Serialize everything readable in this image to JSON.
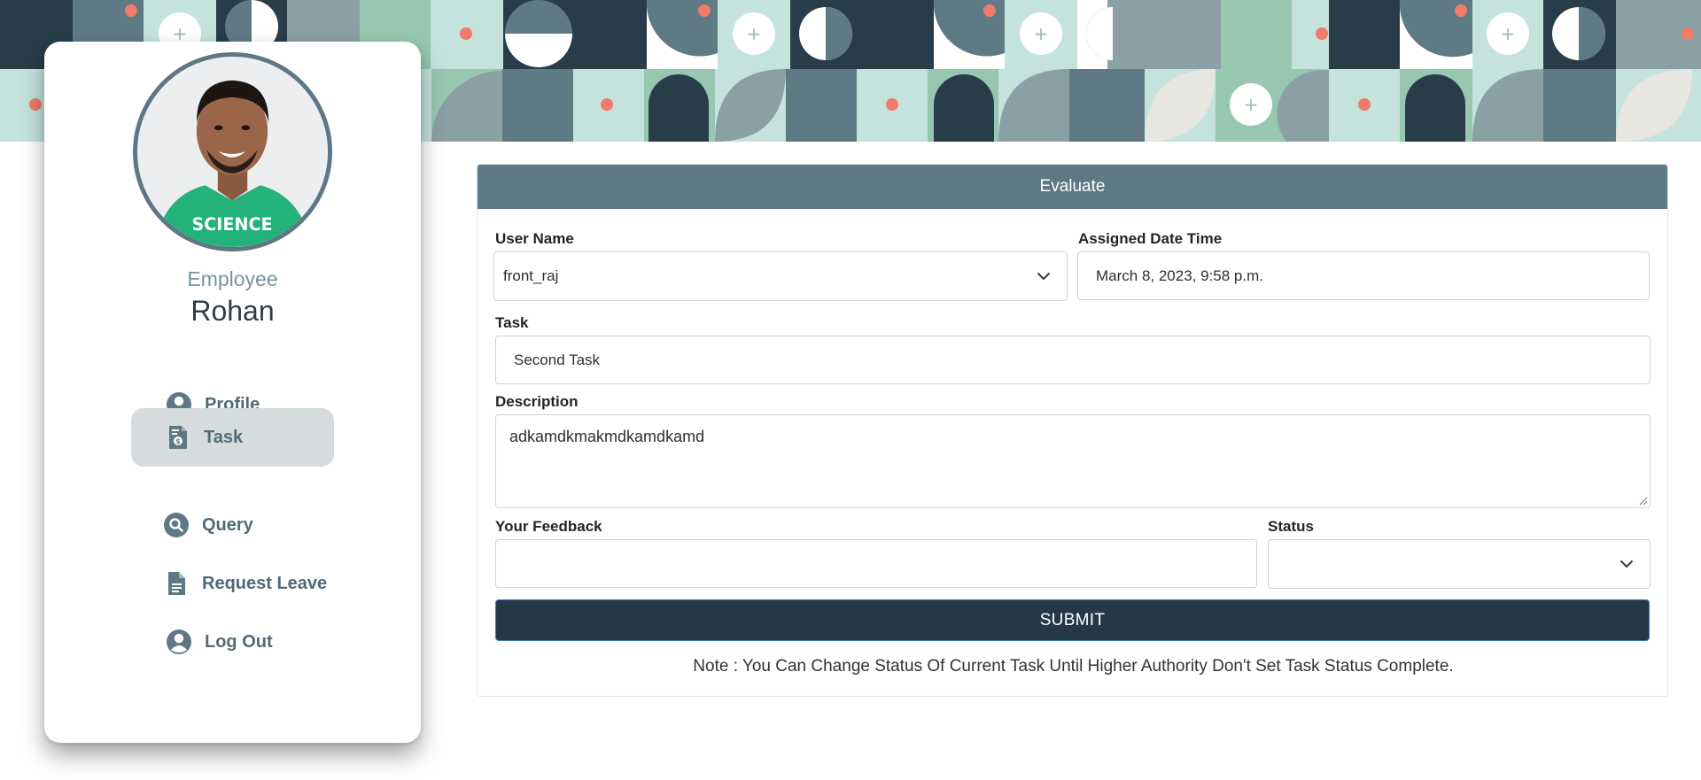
{
  "profile": {
    "role": "Employee",
    "name": "Rohan",
    "avatar_alt": "Employee photo",
    "avatar_shirt_text": "SCIENCE"
  },
  "nav": [
    {
      "label": "Profile",
      "icon": "user-circle-icon",
      "active": false
    },
    {
      "label": "Task",
      "icon": "task-icon",
      "active": true
    },
    {
      "label": "Query",
      "icon": "search-icon",
      "active": false
    },
    {
      "label": "Request Leave",
      "icon": "document-icon",
      "active": false
    },
    {
      "label": "Log Out",
      "icon": "user-circle-icon",
      "active": false
    }
  ],
  "form": {
    "title": "Evaluate",
    "user_name_label": "User Name",
    "user_name_value": "front_raj",
    "assigned_label": "Assigned Date Time",
    "assigned_value": "March 8, 2023, 9:58 p.m.",
    "task_label": "Task",
    "task_value": "Second Task",
    "description_label": "Description",
    "description_value": "adkamdkmakmdkamdkamd",
    "feedback_label": "Your Feedback",
    "feedback_value": "",
    "status_label": "Status",
    "status_value": "",
    "submit_label": "SUBMIT",
    "note": "Note : You Can Change Status Of Current Task Until Higher Authority Don't Set Task Status Complete."
  },
  "colors": {
    "header": "#5e7984",
    "submit": "#253847",
    "active_nav": "#d6dbde",
    "nav_text": "#4f6b78",
    "accent_dot": "#ef7b68"
  }
}
